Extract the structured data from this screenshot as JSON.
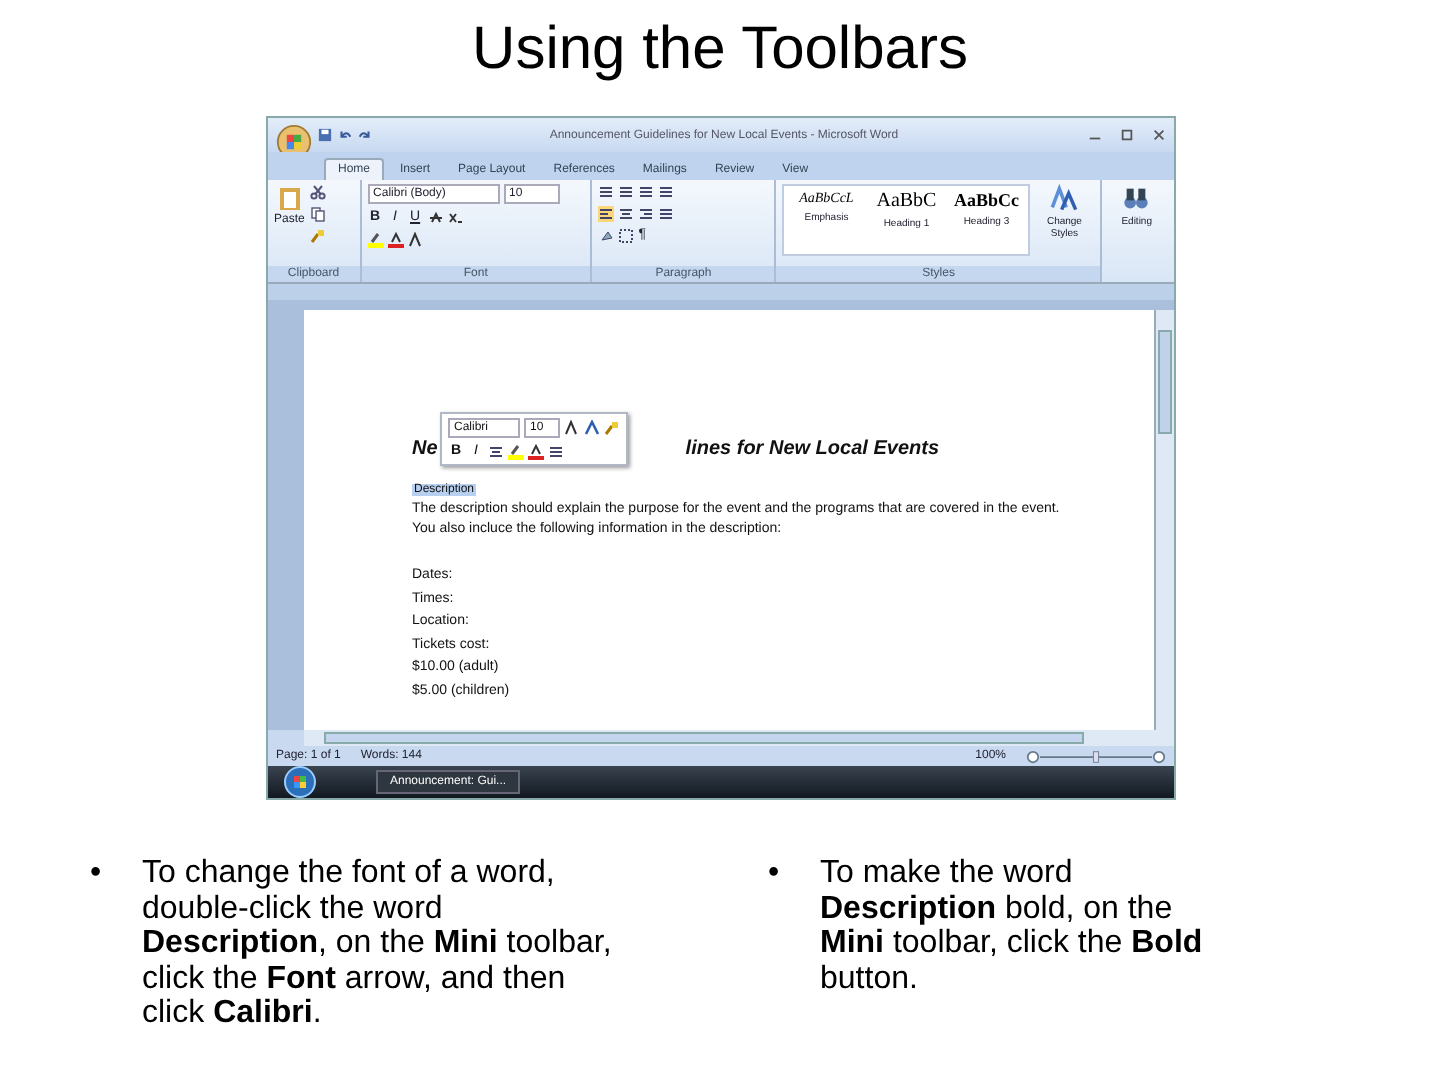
{
  "title": "Using the Toolbars",
  "screenshot": {
    "window_title": "Announcement Guidelines for New Local Events - Microsoft Word",
    "tabs": [
      {
        "label": "Home",
        "selected": true
      },
      {
        "label": "Insert",
        "selected": false
      },
      {
        "label": "Page Layout",
        "selected": false
      },
      {
        "label": "References",
        "selected": false
      },
      {
        "label": "Mailings",
        "selected": false
      },
      {
        "label": "Review",
        "selected": false
      },
      {
        "label": "View",
        "selected": false
      }
    ],
    "clipboard": {
      "paste": "Paste",
      "label": "Clipboard"
    },
    "font": {
      "name": "Calibri (Body)",
      "size": "10",
      "buttons": [
        "B",
        "I",
        "U"
      ],
      "label": "Font"
    },
    "paragraph": {
      "pilcrow": "¶",
      "label": "Paragraph"
    },
    "styles": {
      "items": [
        {
          "preview": "AaBbCcL",
          "name": "Emphasis",
          "kind": "italic"
        },
        {
          "preview": "AaBbC",
          "name": "Heading 1",
          "kind": "large"
        },
        {
          "preview": "AaBbCc",
          "name": "Heading 3",
          "kind": "bold"
        }
      ],
      "change": "Change Styles",
      "label": "Styles"
    },
    "editing": {
      "label": "Editing"
    },
    "document": {
      "heading_start": "Ne",
      "heading_end": "lines for New Local Events",
      "mini_toolbar": {
        "font": "Calibri",
        "size": "10",
        "buttons": [
          "B",
          "I"
        ]
      },
      "selected_word": "Description",
      "paragraph": "The description should explain the purpose for the event and the programs that are covered in the event. You also incluce the following information in the description:",
      "lines": [
        "Dates:",
        "Times:",
        "Location:",
        "Tickets cost:",
        "$10.00 (adult)",
        "$5.00 (children)"
      ]
    },
    "status_bar": {
      "page": "Page: 1 of 1",
      "words": "Words: 144",
      "zoom": "100%",
      "zoom_slider": {
        "level": 0.5
      }
    },
    "taskbar": {
      "window": "Announcement: Gui..."
    }
  },
  "bullets": [
    {
      "marker": "•",
      "text": "To change the font of a word, double-click the word **Description**, on the **Mini** toolbar, click the **Font** arrow, and then click **Calibri**."
    },
    {
      "marker": "•",
      "text": "To make the word **Description** bold, on the **Mini** toolbar, click the **Bold** button."
    }
  ]
}
